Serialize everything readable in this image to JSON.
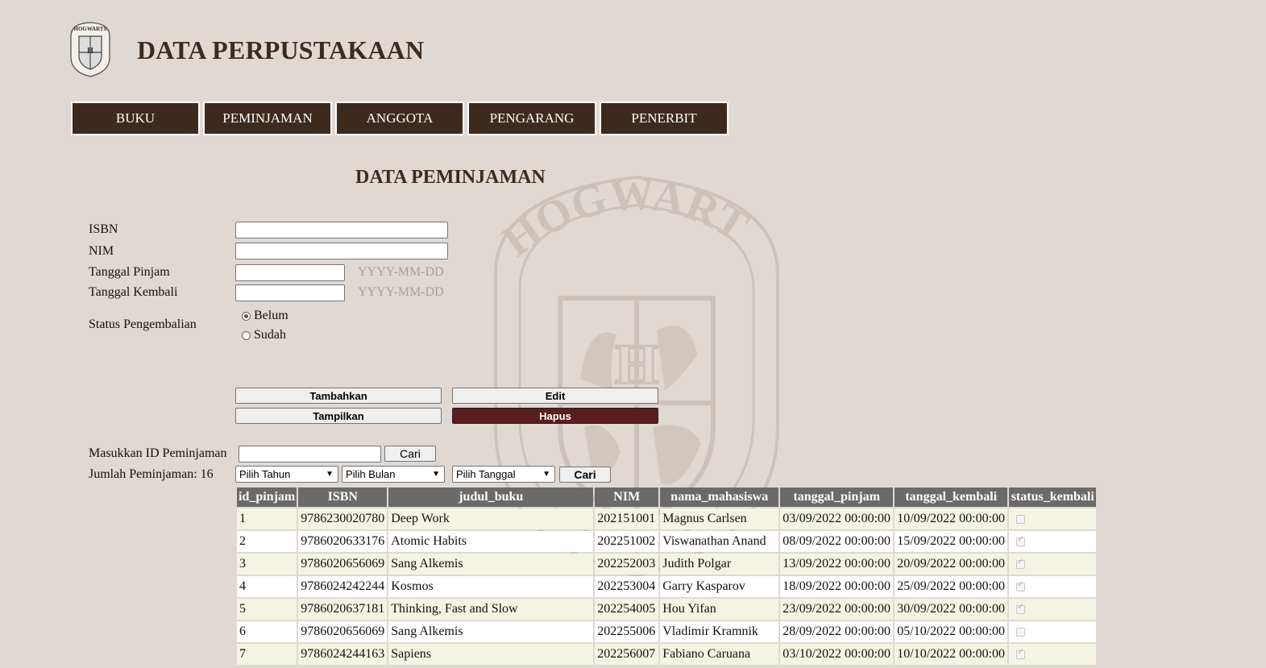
{
  "header": {
    "logo_text": "HOGWARTS",
    "title": "DATA PERPUSTAKAAN"
  },
  "watermark_text": "HOGWARTS",
  "nav": [
    "BUKU",
    "PEMINJAMAN",
    "ANGGOTA",
    "PENGARANG",
    "PENERBIT"
  ],
  "page_title": "DATA PEMINJAMAN",
  "form": {
    "isbn_label": "ISBN",
    "isbn_value": "",
    "nim_label": "NIM",
    "nim_value": "",
    "tgl_pinjam_label": "Tanggal Pinjam",
    "tgl_pinjam_value": "",
    "tgl_pinjam_hint": "YYYY-MM-DD",
    "tgl_kembali_label": "Tanggal Kembali",
    "tgl_kembali_value": "",
    "tgl_kembali_hint": "YYYY-MM-DD",
    "status_label": "Status Pengembalian",
    "status_options": [
      "Belum",
      "Sudah"
    ],
    "status_selected": "Belum"
  },
  "actions": {
    "add": "Tambahkan",
    "edit": "Edit",
    "show": "Tampilkan",
    "delete": "Hapus"
  },
  "search": {
    "id_label": "Masukkan ID Peminjaman",
    "id_value": "",
    "search_button": "Cari",
    "count_label": "Jumlah Peminjaman: 16",
    "year_select": "Pilih Tahun",
    "month_select": "Pilih Bulan",
    "day_select": "Pilih Tanggal",
    "filter_button": "Cari"
  },
  "table": {
    "columns": [
      "id_pinjam",
      "ISBN",
      "judul_buku",
      "NIM",
      "nama_mahasiswa",
      "tanggal_pinjam",
      "tanggal_kembali",
      "status_kembali"
    ],
    "rows": [
      {
        "id": "1",
        "isbn": "9786230020780",
        "judul": "Deep Work",
        "nim": "202151001",
        "nama": "Magnus Carlsen",
        "pinjam": "03/09/2022 00:00:00",
        "kembali": "10/09/2022 00:00:00",
        "status": false
      },
      {
        "id": "2",
        "isbn": "9786020633176",
        "judul": "Atomic Habits",
        "nim": "202251002",
        "nama": "Viswanathan Anand",
        "pinjam": "08/09/2022 00:00:00",
        "kembali": "15/09/2022 00:00:00",
        "status": true
      },
      {
        "id": "3",
        "isbn": "9786020656069",
        "judul": "Sang Alkemis",
        "nim": "202252003",
        "nama": "Judith Polgar",
        "pinjam": "13/09/2022 00:00:00",
        "kembali": "20/09/2022 00:00:00",
        "status": true
      },
      {
        "id": "4",
        "isbn": "9786024242244",
        "judul": "Kosmos",
        "nim": "202253004",
        "nama": "Garry Kasparov",
        "pinjam": "18/09/2022 00:00:00",
        "kembali": "25/09/2022 00:00:00",
        "status": true
      },
      {
        "id": "5",
        "isbn": "9786020637181",
        "judul": "Thinking, Fast and Slow",
        "nim": "202254005",
        "nama": "Hou Yifan",
        "pinjam": "23/09/2022 00:00:00",
        "kembali": "30/09/2022 00:00:00",
        "status": true
      },
      {
        "id": "6",
        "isbn": "9786020656069",
        "judul": "Sang Alkemis",
        "nim": "202255006",
        "nama": "Vladimir Kramnik",
        "pinjam": "28/09/2022 00:00:00",
        "kembali": "05/10/2022 00:00:00",
        "status": false
      },
      {
        "id": "7",
        "isbn": "9786024244163",
        "judul": "Sapiens",
        "nim": "202256007",
        "nama": "Fabiano Caruana",
        "pinjam": "03/10/2022 00:00:00",
        "kembali": "10/10/2022 00:00:00",
        "status": true
      }
    ]
  },
  "colors": {
    "brand_brown": "#3d2a1c",
    "title_brown": "#3d2b1f",
    "danger": "#5b1d1d",
    "table_header": "#6a6a6a",
    "row_odd": "#f4f4e2",
    "background": "#e0d8d3"
  }
}
